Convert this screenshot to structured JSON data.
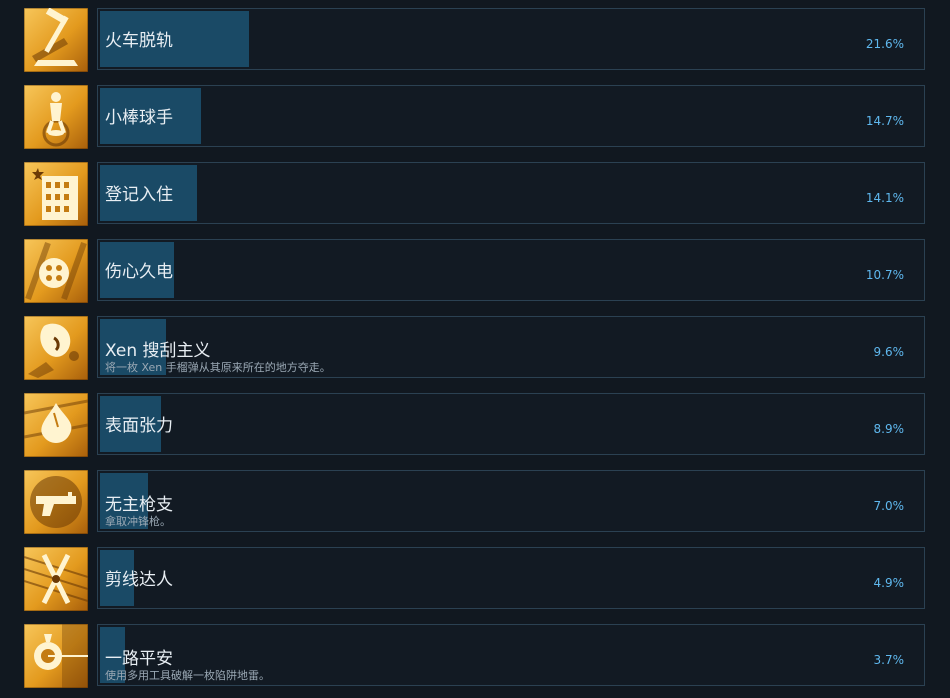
{
  "accent_color": "#5fb8ee",
  "bar_color": "#1a4a66",
  "icon_gold": "#f7c65a",
  "achievements": [
    {
      "title": "火车脱轨",
      "desc": "",
      "percent_label": "21.6%",
      "percent": 21.6,
      "icon": "hammer-icon"
    },
    {
      "title": "小棒球手",
      "desc": "",
      "percent_label": "14.7%",
      "percent": 14.7,
      "icon": "baseball-player-icon"
    },
    {
      "title": "登记入住",
      "desc": "",
      "percent_label": "14.1%",
      "percent": 14.1,
      "icon": "building-icon"
    },
    {
      "title": "伤心久电",
      "desc": "",
      "percent_label": "10.7%",
      "percent": 10.7,
      "icon": "battery-icon"
    },
    {
      "title": "Xen 搜刮主义",
      "desc": "将一枚 Xen 手榴弹从其原来所在的地方夺走。",
      "percent_label": "9.6%",
      "percent": 9.6,
      "icon": "xen-grenade-icon"
    },
    {
      "title": "表面张力",
      "desc": "",
      "percent_label": "8.9%",
      "percent": 8.9,
      "icon": "splash-icon"
    },
    {
      "title": "无主枪支",
      "desc": "拿取冲锋枪。",
      "percent_label": "7.0%",
      "percent": 7.0,
      "icon": "pistol-icon"
    },
    {
      "title": "剪线达人",
      "desc": "",
      "percent_label": "4.9%",
      "percent": 4.9,
      "icon": "wire-cutter-icon"
    },
    {
      "title": "一路平安",
      "desc": "使用多用工具破解一枚陷阱地雷。",
      "percent_label": "3.7%",
      "percent": 3.7,
      "icon": "tripmine-icon"
    }
  ]
}
